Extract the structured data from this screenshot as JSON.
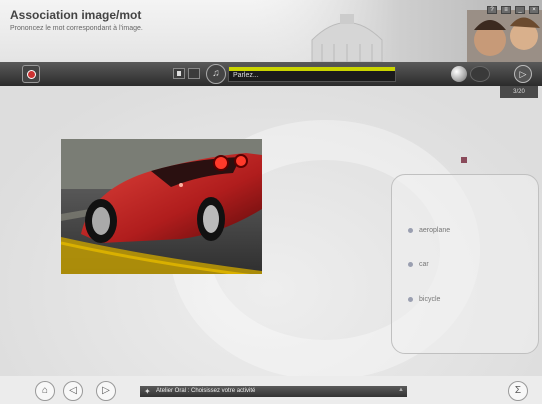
{
  "header": {
    "title": "Association image/mot",
    "subtitle": "Prononcez le mot correspondant à l'image."
  },
  "toolbar": {
    "speak_label": "Parlez...",
    "progress": "3/20"
  },
  "answers": [
    {
      "label": "aeroplane"
    },
    {
      "label": "car"
    },
    {
      "label": "bicycle"
    }
  ],
  "footer": {
    "status_text": "Atelier Oral : Choisissez votre activité"
  },
  "colors": {
    "level_bar": "#c9d400",
    "marker": "#8a4a5a",
    "car": "#b01d1d"
  },
  "icons": [
    "home-icon",
    "back-icon",
    "forward-icon",
    "sigma-icon",
    "mic-icon",
    "next-icon",
    "record-icon"
  ]
}
